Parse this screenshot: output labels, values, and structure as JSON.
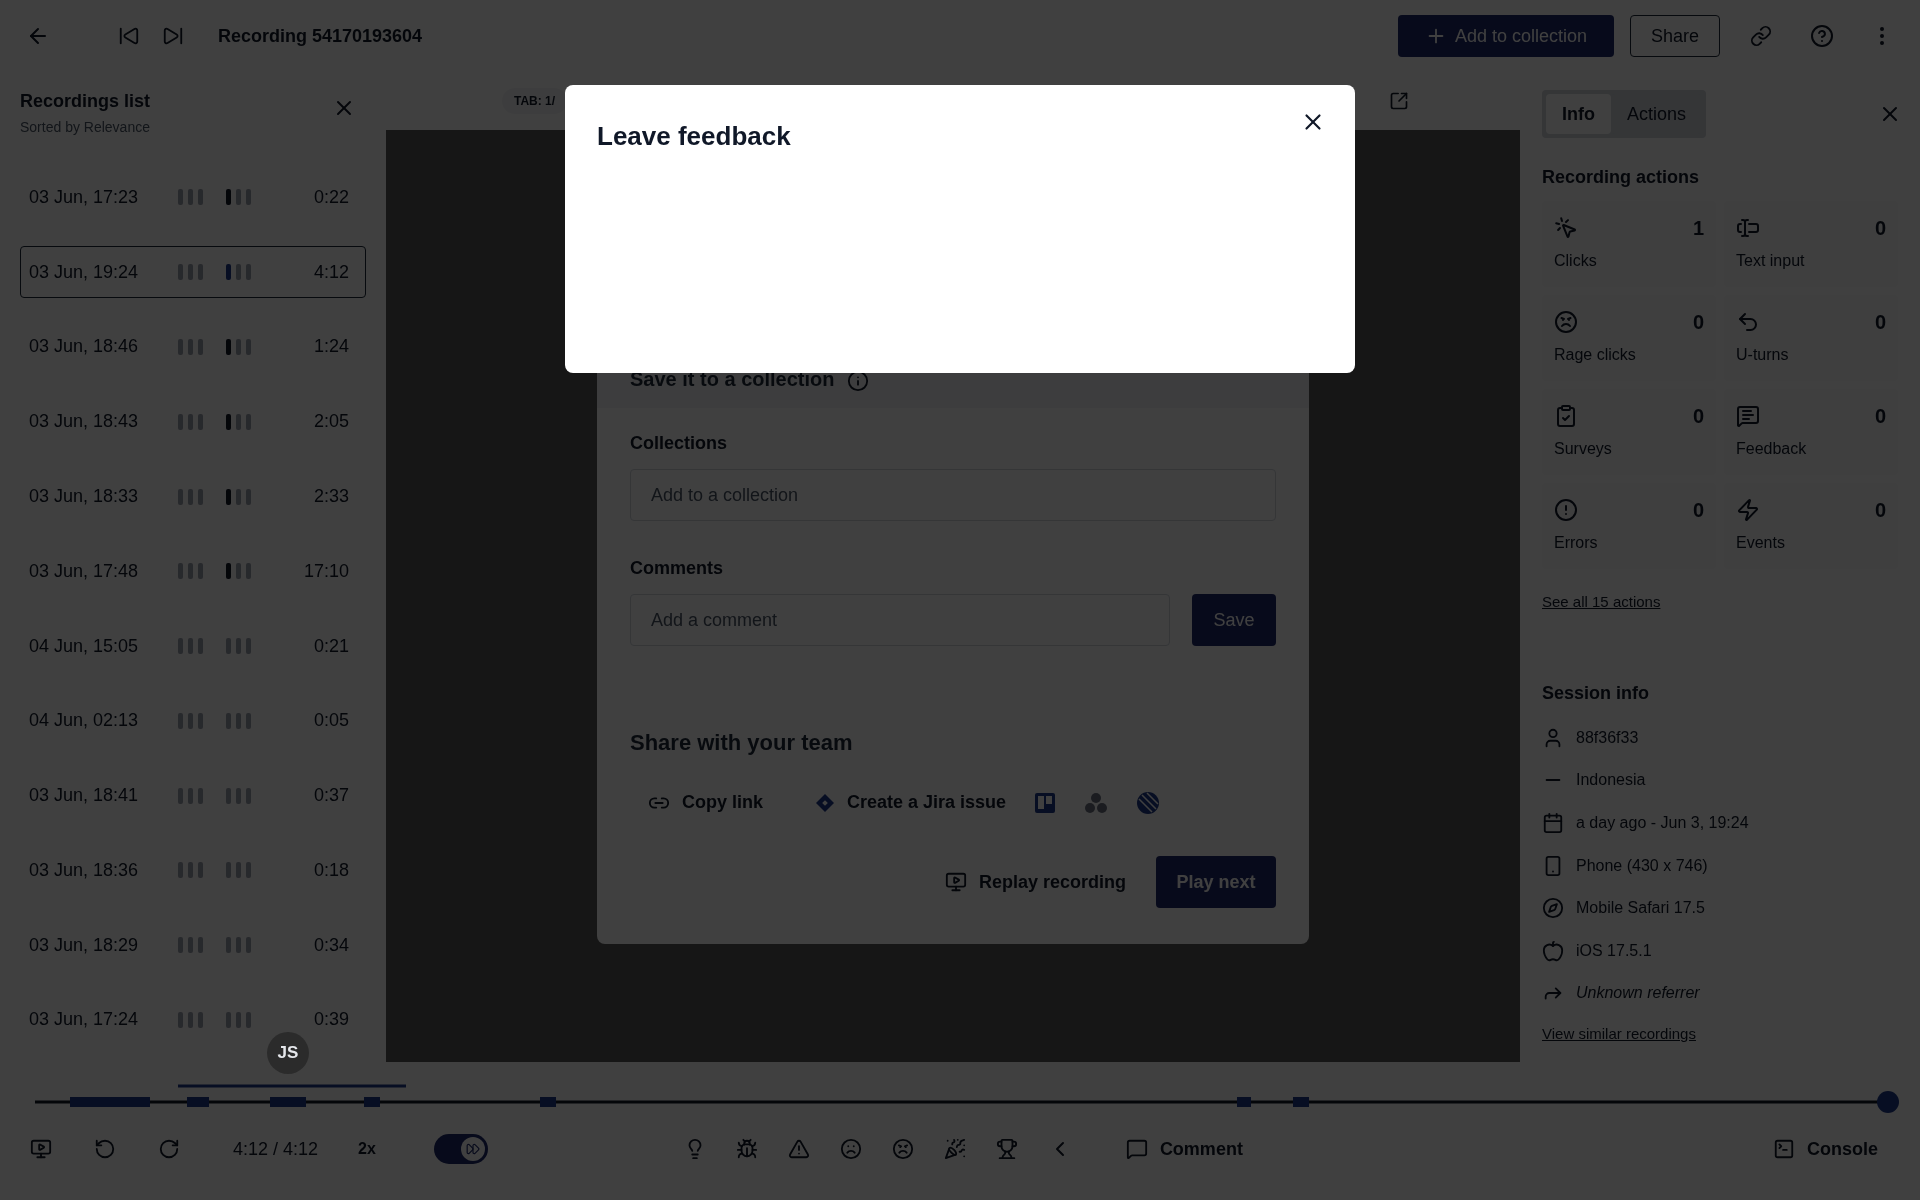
{
  "header": {
    "title": "Recording 54170193604",
    "add_button": "Add to collection",
    "share_button": "Share"
  },
  "recordings_list": {
    "title": "Recordings list",
    "subtitle": "Sorted by Relevance",
    "rows": [
      {
        "date": "03 Jun, 17:23",
        "duration": "0:22",
        "selected": false,
        "active": true
      },
      {
        "date": "03 Jun, 19:24",
        "duration": "4:12",
        "selected": true,
        "active": true
      },
      {
        "date": "03 Jun, 18:46",
        "duration": "1:24",
        "selected": false,
        "active": true
      },
      {
        "date": "03 Jun, 18:43",
        "duration": "2:05",
        "selected": false,
        "active": true
      },
      {
        "date": "03 Jun, 18:33",
        "duration": "2:33",
        "selected": false,
        "active": true
      },
      {
        "date": "03 Jun, 17:48",
        "duration": "17:10",
        "selected": false,
        "active": true
      },
      {
        "date": "04 Jun, 15:05",
        "duration": "0:21",
        "selected": false,
        "active": false
      },
      {
        "date": "04 Jun, 02:13",
        "duration": "0:05",
        "selected": false,
        "active": false
      },
      {
        "date": "03 Jun, 18:41",
        "duration": "0:37",
        "selected": false,
        "active": false
      },
      {
        "date": "03 Jun, 18:36",
        "duration": "0:18",
        "selected": false,
        "active": false
      },
      {
        "date": "03 Jun, 18:29",
        "duration": "0:34",
        "selected": false,
        "active": false
      },
      {
        "date": "03 Jun, 17:24",
        "duration": "0:39",
        "selected": false,
        "active": false
      }
    ],
    "avatar": "JS"
  },
  "player": {
    "tab_label": "TAB: 1/",
    "end_card": {
      "collection_title": "Save it to a collection",
      "collections_label": "Collections",
      "collections_placeholder": "Add to a collection",
      "comments_label": "Comments",
      "comments_placeholder": "Add a comment",
      "save_button": "Save",
      "share_title": "Share with your team",
      "copy_link": "Copy link",
      "jira": "Create a Jira issue",
      "replay": "Replay recording",
      "play_next": "Play next"
    }
  },
  "modal": {
    "title": "Leave feedback"
  },
  "side_panel": {
    "tabs": [
      {
        "label": "Info",
        "selected": true
      },
      {
        "label": "Actions",
        "selected": false
      }
    ],
    "actions_title": "Recording actions",
    "actions": [
      {
        "kind": "clicks",
        "label": "Clicks",
        "count": "1"
      },
      {
        "kind": "text",
        "label": "Text input",
        "count": "0"
      },
      {
        "kind": "rage",
        "label": "Rage clicks",
        "count": "0"
      },
      {
        "kind": "uturn",
        "label": "U-turns",
        "count": "0"
      },
      {
        "kind": "survey",
        "label": "Surveys",
        "count": "0"
      },
      {
        "kind": "feedback",
        "label": "Feedback",
        "count": "0"
      },
      {
        "kind": "error",
        "label": "Errors",
        "count": "0"
      },
      {
        "kind": "event",
        "label": "Events",
        "count": "0"
      }
    ],
    "see_all": "See all 15 actions",
    "session_title": "Session info",
    "session_items": [
      {
        "kind": "user",
        "text": "88f36f33"
      },
      {
        "kind": "country",
        "text": "Indonesia"
      },
      {
        "kind": "date",
        "text": "a day ago - Jun 3, 19:24"
      },
      {
        "kind": "device",
        "text": "Phone (430 x 746)"
      },
      {
        "kind": "browser",
        "text": "Mobile Safari 17.5"
      },
      {
        "kind": "os",
        "text": "iOS 17.5.1"
      },
      {
        "kind": "referrer",
        "text": "Unknown referrer"
      }
    ],
    "similar_link": "View similar recordings"
  },
  "timeline": {
    "level": 1
  },
  "controls": {
    "time": "4:12 / 4:12",
    "speed": "2x",
    "skip_inactive": {
      "on": true
    },
    "comment": "Comment",
    "console": "Console"
  }
}
